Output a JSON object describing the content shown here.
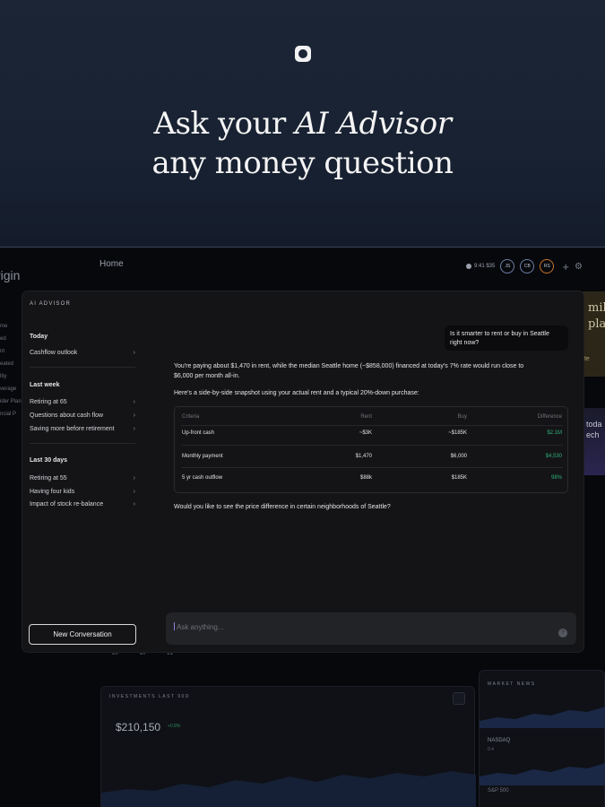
{
  "hero": {
    "line1_prefix": "Ask your ",
    "line1_em": "AI Advisor",
    "line2": "any money question"
  },
  "app": {
    "brand": "rigin",
    "nav_home": "Home",
    "top_status": "9:41 $35",
    "avatars": [
      "JS",
      "CB",
      "RS"
    ],
    "plus": "+",
    "left_nav": [
      "me",
      "ed",
      "nt",
      "eated",
      "lity",
      "",
      "verage",
      "ider Plan",
      "",
      "ncial P"
    ],
    "right_card_text": "mily\nplan",
    "right_card_link": "Ite",
    "right_dark_text": "toda\nech",
    "cal_days": [
      "20",
      "20",
      "21"
    ],
    "investments_title": "INVESTMENTS LAST 90D",
    "investments_value": "$210,150",
    "investments_badge": "+0.8%",
    "market_title": "MARKET NEWS",
    "market_l1": "NASDAQ",
    "market_l2": "0.4",
    "market_l3": "S&P 500"
  },
  "modal": {
    "title": "AI ADVISOR",
    "sections": [
      {
        "label": "Today",
        "items": [
          "Cashflow outlook"
        ]
      },
      {
        "label": "Last week",
        "items": [
          "Retiring at 65",
          "Questions about cash flow",
          "Saving more before retirement"
        ]
      },
      {
        "label": "Last 30 days",
        "items": [
          "Retiring at 55",
          "Having four kids",
          "Impact of stock re-balance"
        ]
      }
    ],
    "new_conversation": "New Conversation",
    "user_question": "Is it smarter to rent or buy in Seattle right now?",
    "answer_p1_l1": "You're paying about $1,470 in rent, while the median Seattle home (~$858,000) financed at today's 7% rate would run close to",
    "answer_p1_l2": "$6,000 per month all-in.",
    "answer_p2": "Here's a side-by-side snapshot using your actual rent and a typical 20%-down purchase:",
    "table": {
      "headers": [
        "Criteria",
        "Rent",
        "Buy",
        "Difference"
      ],
      "rows": [
        [
          "Up-front cash",
          "~$3K",
          "~$185K",
          "$2.1M"
        ],
        [
          "Monthly payment",
          "$1,470",
          "$6,000",
          "$4,530"
        ],
        [
          "5 yr cash outflow",
          "$88k",
          "$185K",
          "98%"
        ]
      ]
    },
    "answer_p3": "Would you like to see the price difference in certain neighborhoods of Seattle?",
    "chat_placeholder": "Ask anything...",
    "help": "?"
  }
}
